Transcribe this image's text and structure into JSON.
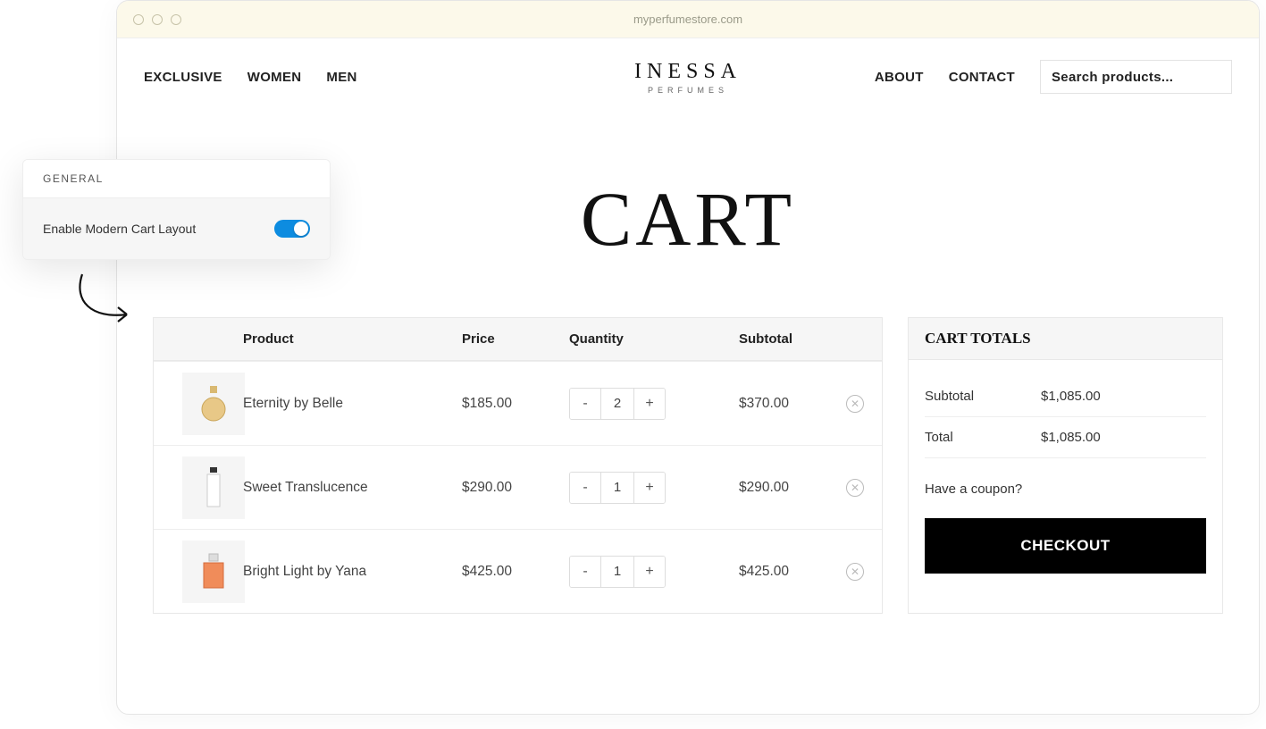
{
  "browser": {
    "url": "myperfumestore.com"
  },
  "nav": {
    "left": [
      "EXCLUSIVE",
      "WOMEN",
      "MEN"
    ],
    "right": [
      "ABOUT",
      "CONTACT"
    ],
    "search_placeholder": "Search products..."
  },
  "logo": {
    "brand": "INESSA",
    "sub": "PERFUMES"
  },
  "page_title": "CART",
  "table": {
    "headers": {
      "product": "Product",
      "price": "Price",
      "quantity": "Quantity",
      "subtotal": "Subtotal"
    },
    "rows": [
      {
        "name": "Eternity by Belle",
        "price": "$185.00",
        "qty": "2",
        "subtotal": "$370.00"
      },
      {
        "name": "Sweet Translucence",
        "price": "$290.00",
        "qty": "1",
        "subtotal": "$290.00"
      },
      {
        "name": "Bright Light by Yana",
        "price": "$425.00",
        "qty": "1",
        "subtotal": "$425.00"
      }
    ]
  },
  "totals": {
    "heading": "CART TOTALS",
    "subtotal_label": "Subtotal",
    "subtotal_value": "$1,085.00",
    "total_label": "Total",
    "total_value": "$1,085.00",
    "coupon": "Have a coupon?",
    "checkout": "CHECKOUT"
  },
  "settings": {
    "heading": "GENERAL",
    "toggle_label": "Enable Modern Cart Layout"
  }
}
